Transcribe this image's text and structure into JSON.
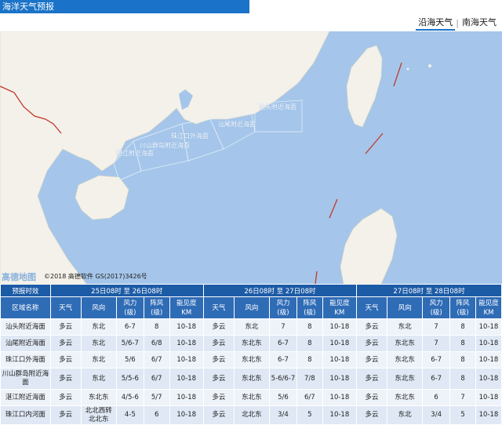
{
  "header": {
    "title": "海洋天气预报"
  },
  "tabs": [
    {
      "label": "沿海天气",
      "active": true
    },
    {
      "label": "南海天气",
      "active": false
    }
  ],
  "map": {
    "area_labels": [
      "汕头附近海面",
      "汕尾附近海面",
      "珠江口外海面",
      "川山群岛附近海面",
      "湛江附近海面"
    ],
    "logo": "高德地图",
    "copyright": "©2018 高德软件 GS(2017)3426号",
    "colors": {
      "sea": "#a5c6ea",
      "land": "#f3f1e9",
      "border": "#c0392b"
    }
  },
  "table": {
    "corner_label": "预报时效",
    "periods": [
      "25日08时 至 26日08时",
      "26日08时 至 27日08时",
      "27日08时 至 28日08时"
    ],
    "area_header": "区域名称",
    "columns": [
      "天气",
      "风向",
      "风力\n(级)",
      "阵风\n(级)",
      "能见度\nKM"
    ],
    "rows": [
      {
        "area": "汕头附近海面",
        "p1": [
          "多云",
          "东北",
          "6-7",
          "8",
          "10-18"
        ],
        "p2": [
          "多云",
          "东北",
          "7",
          "8",
          "10-18"
        ],
        "p3": [
          "多云",
          "东北",
          "7",
          "8",
          "10-18"
        ]
      },
      {
        "area": "汕尾附近海面",
        "p1": [
          "多云",
          "东北",
          "5/6-7",
          "6/8",
          "10-18"
        ],
        "p2": [
          "多云",
          "东北东",
          "6-7",
          "8",
          "10-18"
        ],
        "p3": [
          "多云",
          "东北东",
          "7",
          "8",
          "10-18"
        ]
      },
      {
        "area": "珠江口外海面",
        "p1": [
          "多云",
          "东北",
          "5/6",
          "6/7",
          "10-18"
        ],
        "p2": [
          "多云",
          "东北东",
          "6-7",
          "8",
          "10-18"
        ],
        "p3": [
          "多云",
          "东北东",
          "6-7",
          "8",
          "10-18"
        ]
      },
      {
        "area": "川山群岛附近海面",
        "p1": [
          "多云",
          "东北",
          "5/5-6",
          "6/7",
          "10-18"
        ],
        "p2": [
          "多云",
          "东北东",
          "5-6/6-7",
          "7/8",
          "10-18"
        ],
        "p3": [
          "多云",
          "东北东",
          "6-7",
          "8",
          "10-18"
        ]
      },
      {
        "area": "湛江附近海面",
        "p1": [
          "多云",
          "东北东",
          "4/5-6",
          "5/7",
          "10-18"
        ],
        "p2": [
          "多云",
          "东北东",
          "5/6",
          "6/7",
          "10-18"
        ],
        "p3": [
          "多云",
          "东北东",
          "6",
          "7",
          "10-18"
        ]
      },
      {
        "area": "珠江口内河面",
        "p1": [
          "多云",
          "北北西转\n北北东",
          "4-5",
          "6",
          "10-18"
        ],
        "p2": [
          "多云",
          "北北东",
          "3/4",
          "5",
          "10-18"
        ],
        "p3": [
          "多云",
          "东北",
          "3/4",
          "5",
          "10-18"
        ]
      }
    ]
  }
}
